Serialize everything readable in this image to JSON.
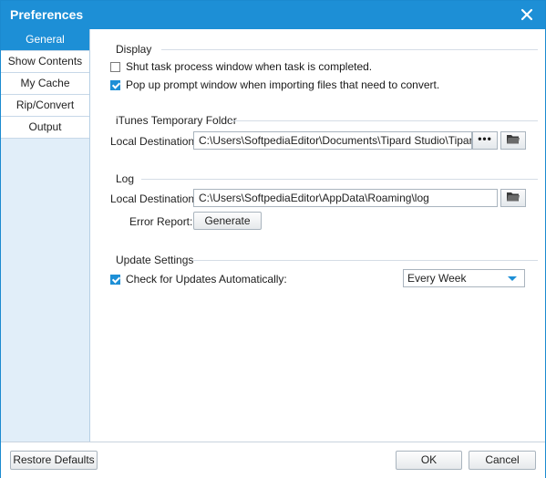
{
  "window": {
    "title": "Preferences"
  },
  "sidebar": {
    "items": [
      {
        "label": "General",
        "active": true
      },
      {
        "label": "Show Contents",
        "active": false
      },
      {
        "label": "My Cache",
        "active": false
      },
      {
        "label": "Rip/Convert",
        "active": false
      },
      {
        "label": "Output",
        "active": false
      }
    ]
  },
  "display": {
    "title": "Display",
    "shut_task": {
      "label": "Shut task process window when task is completed.",
      "checked": false
    },
    "popup_prompt": {
      "label": "Pop up prompt window when importing files that need to convert.",
      "checked": true
    }
  },
  "itunes": {
    "title": "iTunes Temporary Folder",
    "dest_label": "Local Destination:",
    "dest_value": "C:\\Users\\SoftpediaEditor\\Documents\\Tipard Studio\\Tipard iPod Transfer"
  },
  "log": {
    "title": "Log",
    "dest_label": "Local Destination:",
    "dest_value": "C:\\Users\\SoftpediaEditor\\AppData\\Roaming\\log",
    "error_label": "Error Report:",
    "generate_label": "Generate"
  },
  "update": {
    "title": "Update Settings",
    "check_label": "Check for Updates Automatically:",
    "checked": true,
    "frequency": "Every Week"
  },
  "footer": {
    "restore_label": "Restore Defaults",
    "ok_label": "OK",
    "cancel_label": "Cancel"
  },
  "icons": {
    "close": "close-icon",
    "browse": "ellipsis-icon",
    "folder": "folder-icon",
    "dropdown": "dropdown-arrow-icon"
  },
  "colors": {
    "accent": "#1d8fd6",
    "sidebar_bg": "#e1eef9"
  }
}
